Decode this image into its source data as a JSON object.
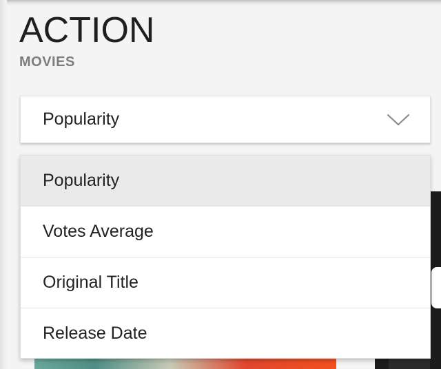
{
  "header": {
    "title": "ACTION",
    "subtitle": "MOVIES"
  },
  "sort_select": {
    "value": "Popularity",
    "icon": "chevron-down-icon"
  },
  "sort_menu": {
    "items": [
      {
        "label": "Popularity",
        "selected": true
      },
      {
        "label": "Votes Average",
        "selected": false
      },
      {
        "label": "Original Title",
        "selected": false
      },
      {
        "label": "Release Date",
        "selected": false
      }
    ]
  },
  "colors": {
    "background": "#f4f4f4",
    "surface": "#ffffff",
    "selected_item": "#eaeaea",
    "text_primary": "#222222",
    "text_secondary": "#7d7d7d"
  }
}
